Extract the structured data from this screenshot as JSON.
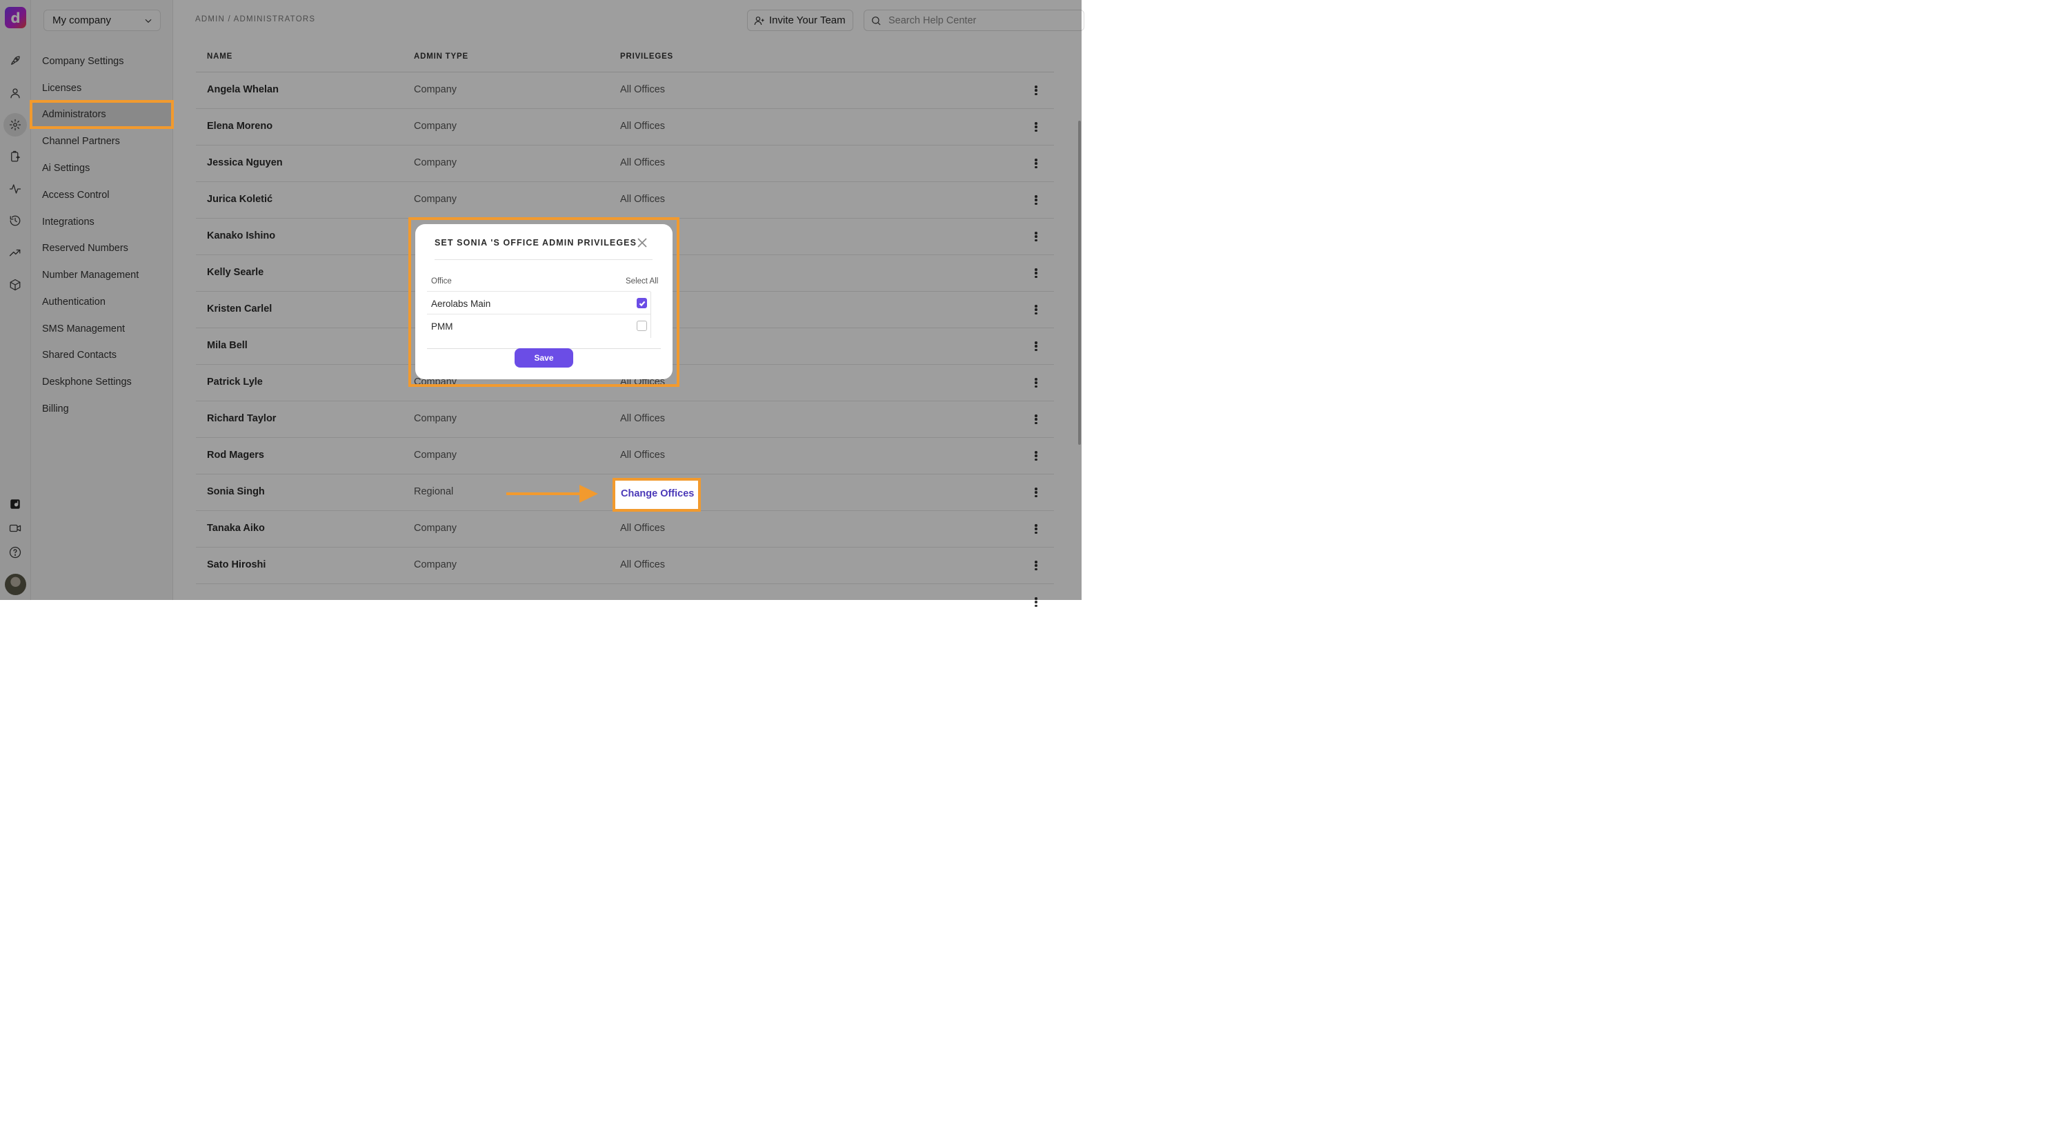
{
  "app": {
    "logo_letter": "d",
    "company_select": "My company",
    "breadcrumb": "ADMIN / ADMINISTRATORS",
    "invite_label": "Invite Your Team",
    "search_placeholder": "Search Help Center",
    "rail_icons": [
      "rocket-icon",
      "person-icon",
      "gear-icon",
      "clipboard-ai-icon",
      "activity-icon",
      "history-icon",
      "trending-up-icon",
      "cube-icon"
    ],
    "rail_bottom_icons": [
      "dialpad-app-icon",
      "video-icon",
      "help-icon"
    ],
    "accent_color": "#6b4de6",
    "highlight_color": "#f29a2e"
  },
  "sidebar": {
    "items": [
      {
        "label": "Company Settings"
      },
      {
        "label": "Licenses"
      },
      {
        "label": "Administrators",
        "active": true
      },
      {
        "label": "Channel Partners"
      },
      {
        "label": "Ai Settings"
      },
      {
        "label": "Access Control"
      },
      {
        "label": "Integrations"
      },
      {
        "label": "Reserved Numbers"
      },
      {
        "label": "Number Management"
      },
      {
        "label": "Authentication"
      },
      {
        "label": "SMS Management"
      },
      {
        "label": "Shared Contacts"
      },
      {
        "label": "Deskphone Settings"
      },
      {
        "label": "Billing"
      }
    ]
  },
  "table": {
    "headers": {
      "name": "NAME",
      "type": "ADMIN TYPE",
      "privileges": "PRIVILEGES"
    },
    "rows": [
      {
        "name": "Angela Whelan",
        "type": "Company",
        "privileges": "All Offices"
      },
      {
        "name": "Elena Moreno",
        "type": "Company",
        "privileges": "All Offices"
      },
      {
        "name": "Jessica Nguyen",
        "type": "Company",
        "privileges": "All Offices"
      },
      {
        "name": "Jurica Koletić",
        "type": "Company",
        "privileges": "All Offices"
      },
      {
        "name": "Kanako Ishino",
        "type": "",
        "privileges": ""
      },
      {
        "name": "Kelly Searle",
        "type": "",
        "privileges": ""
      },
      {
        "name": "Kristen Carlel",
        "type": "",
        "privileges": ""
      },
      {
        "name": "Mila Bell",
        "type": "",
        "privileges": ""
      },
      {
        "name": "Patrick Lyle",
        "type": "Company",
        "privileges": "All Offices"
      },
      {
        "name": "Richard Taylor",
        "type": "Company",
        "privileges": "All Offices"
      },
      {
        "name": "Rod Magers",
        "type": "Company",
        "privileges": "All Offices"
      },
      {
        "name": "Sonia Singh",
        "type": "Regional",
        "privileges": "Change Offices",
        "is_link": true
      },
      {
        "name": "Tanaka Aiko",
        "type": "Company",
        "privileges": "All Offices"
      },
      {
        "name": "Sato Hiroshi",
        "type": "Company",
        "privileges": "All Offices"
      }
    ]
  },
  "modal": {
    "title": "SET SONIA 'S OFFICE ADMIN PRIVILEGES",
    "col_office": "Office",
    "col_select_all": "Select All",
    "offices": [
      {
        "label": "Aerolabs Main",
        "checked": true
      },
      {
        "label": "PMM",
        "checked": false
      }
    ],
    "save_label": "Save"
  }
}
